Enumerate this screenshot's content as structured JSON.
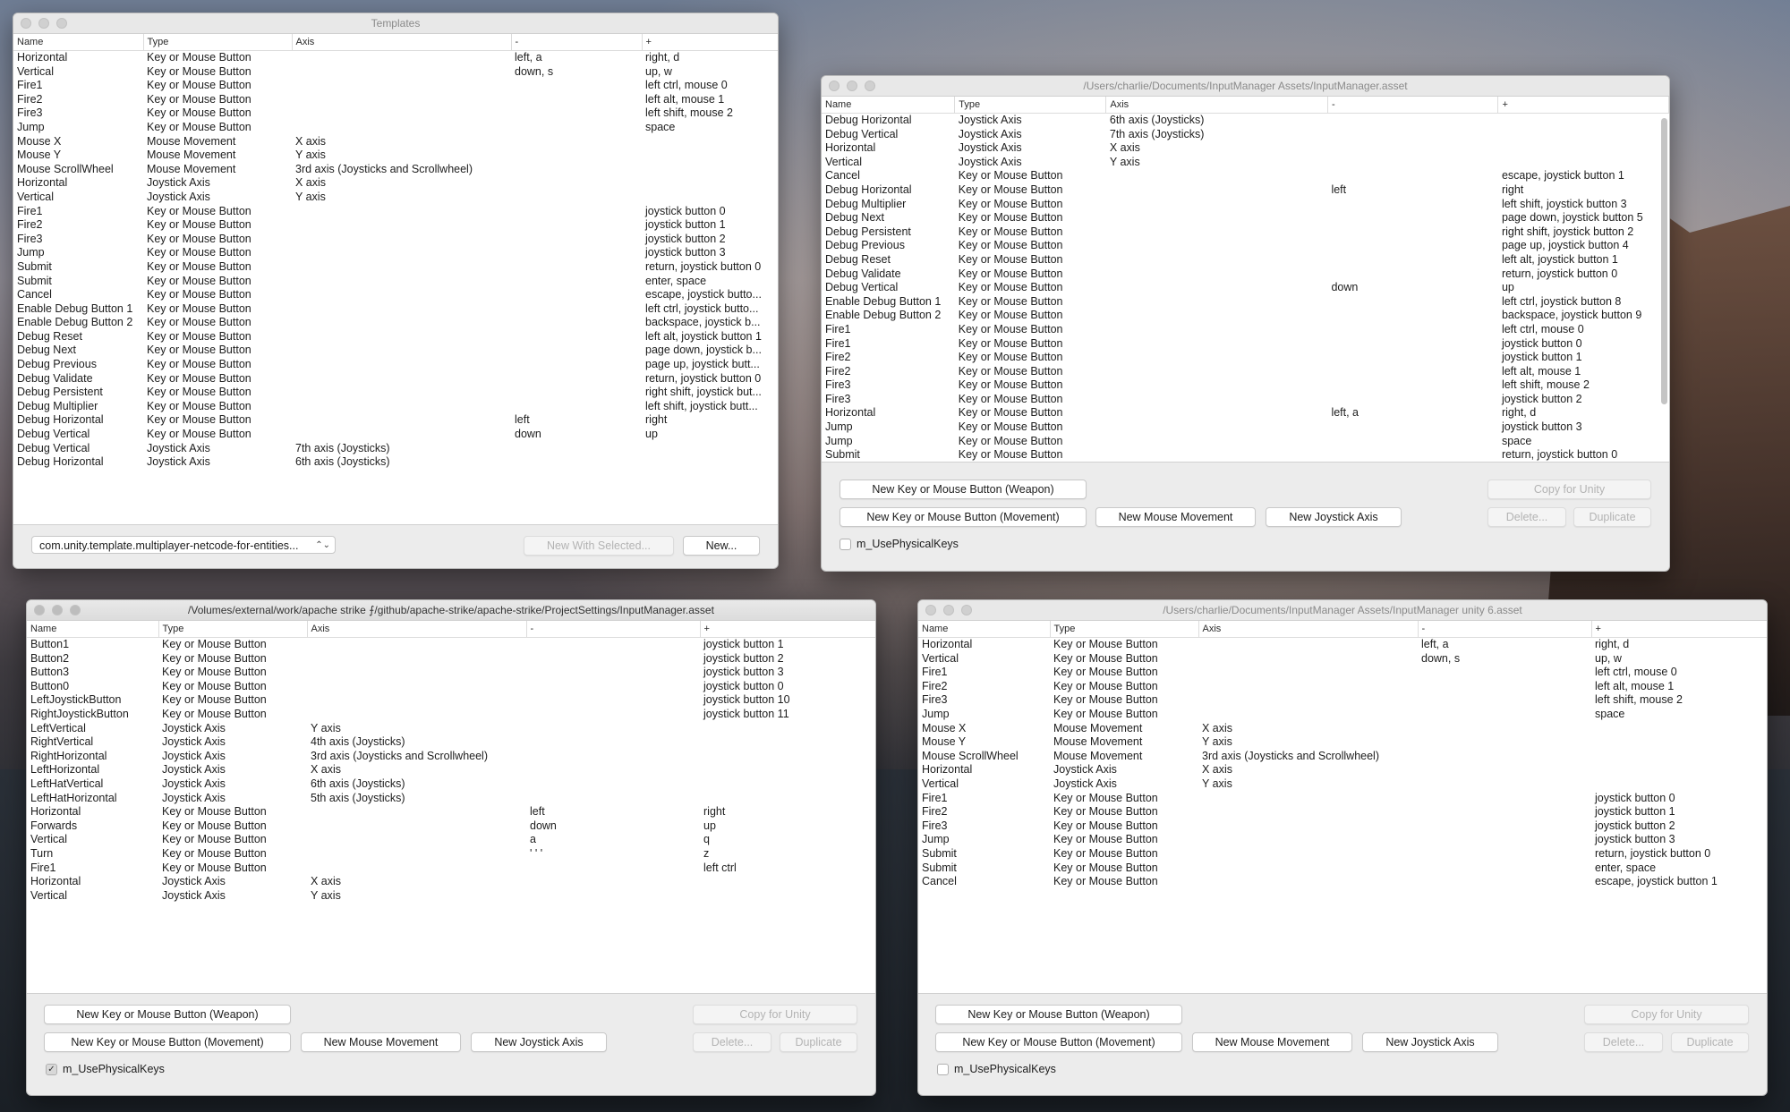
{
  "templates": {
    "title": "Templates",
    "columns": [
      "Name",
      "Type",
      "Axis",
      "-",
      "+"
    ],
    "rows": [
      [
        "Horizontal",
        "Key or Mouse Button",
        "",
        "left, a",
        "right, d"
      ],
      [
        "Vertical",
        "Key or Mouse Button",
        "",
        "down, s",
        "up, w"
      ],
      [
        "Fire1",
        "Key or Mouse Button",
        "",
        "",
        "left ctrl, mouse 0"
      ],
      [
        "Fire2",
        "Key or Mouse Button",
        "",
        "",
        "left alt, mouse 1"
      ],
      [
        "Fire3",
        "Key or Mouse Button",
        "",
        "",
        "left shift, mouse 2"
      ],
      [
        "Jump",
        "Key or Mouse Button",
        "",
        "",
        "space"
      ],
      [
        "Mouse X",
        "Mouse Movement",
        "X axis",
        "",
        ""
      ],
      [
        "Mouse Y",
        "Mouse Movement",
        "Y axis",
        "",
        ""
      ],
      [
        "Mouse ScrollWheel",
        "Mouse Movement",
        "3rd axis (Joysticks and Scrollwheel)",
        "",
        ""
      ],
      [
        "Horizontal",
        "Joystick Axis",
        "X axis",
        "",
        ""
      ],
      [
        "Vertical",
        "Joystick Axis",
        "Y axis",
        "",
        ""
      ],
      [
        "Fire1",
        "Key or Mouse Button",
        "",
        "",
        "joystick button 0"
      ],
      [
        "Fire2",
        "Key or Mouse Button",
        "",
        "",
        "joystick button 1"
      ],
      [
        "Fire3",
        "Key or Mouse Button",
        "",
        "",
        "joystick button 2"
      ],
      [
        "Jump",
        "Key or Mouse Button",
        "",
        "",
        "joystick button 3"
      ],
      [
        "Submit",
        "Key or Mouse Button",
        "",
        "",
        "return, joystick button 0"
      ],
      [
        "Submit",
        "Key or Mouse Button",
        "",
        "",
        "enter, space"
      ],
      [
        "Cancel",
        "Key or Mouse Button",
        "",
        "",
        "escape, joystick butto..."
      ],
      [
        "Enable Debug Button 1",
        "Key or Mouse Button",
        "",
        "",
        "left ctrl, joystick butto..."
      ],
      [
        "Enable Debug Button 2",
        "Key or Mouse Button",
        "",
        "",
        "backspace, joystick b..."
      ],
      [
        "Debug Reset",
        "Key or Mouse Button",
        "",
        "",
        "left alt, joystick button 1"
      ],
      [
        "Debug Next",
        "Key or Mouse Button",
        "",
        "",
        "page down, joystick b..."
      ],
      [
        "Debug Previous",
        "Key or Mouse Button",
        "",
        "",
        "page up, joystick butt..."
      ],
      [
        "Debug Validate",
        "Key or Mouse Button",
        "",
        "",
        "return, joystick button 0"
      ],
      [
        "Debug Persistent",
        "Key or Mouse Button",
        "",
        "",
        "right shift, joystick but..."
      ],
      [
        "Debug Multiplier",
        "Key or Mouse Button",
        "",
        "",
        "left shift, joystick butt..."
      ],
      [
        "Debug Horizontal",
        "Key or Mouse Button",
        "",
        "left",
        "right"
      ],
      [
        "Debug Vertical",
        "Key or Mouse Button",
        "",
        "down",
        "up"
      ],
      [
        "Debug Vertical",
        "Joystick Axis",
        "7th axis (Joysticks)",
        "",
        ""
      ],
      [
        "Debug Horizontal",
        "Joystick Axis",
        "6th axis (Joysticks)",
        "",
        ""
      ]
    ],
    "template_select": "com.unity.template.multiplayer-netcode-for-entities...",
    "select_arrows": "⌃⌄",
    "new_with_selected": "New With Selected...",
    "new": "New..."
  },
  "asset_main": {
    "title": "/Users/charlie/Documents/InputManager Assets/InputManager.asset",
    "columns": [
      "Name",
      "Type",
      "Axis",
      "-",
      "+"
    ],
    "rows": [
      [
        "Debug Horizontal",
        "Joystick Axis",
        "6th axis (Joysticks)",
        "",
        ""
      ],
      [
        "Debug Vertical",
        "Joystick Axis",
        "7th axis (Joysticks)",
        "",
        ""
      ],
      [
        "Horizontal",
        "Joystick Axis",
        "X axis",
        "",
        ""
      ],
      [
        "Vertical",
        "Joystick Axis",
        "Y axis",
        "",
        ""
      ],
      [
        "Cancel",
        "Key or Mouse Button",
        "",
        "",
        "escape, joystick button 1"
      ],
      [
        "Debug Horizontal",
        "Key or Mouse Button",
        "",
        "left",
        "right"
      ],
      [
        "Debug Multiplier",
        "Key or Mouse Button",
        "",
        "",
        "left shift, joystick button 3"
      ],
      [
        "Debug Next",
        "Key or Mouse Button",
        "",
        "",
        "page down, joystick button 5"
      ],
      [
        "Debug Persistent",
        "Key or Mouse Button",
        "",
        "",
        "right shift, joystick button 2"
      ],
      [
        "Debug Previous",
        "Key or Mouse Button",
        "",
        "",
        "page up, joystick button 4"
      ],
      [
        "Debug Reset",
        "Key or Mouse Button",
        "",
        "",
        "left alt, joystick button 1"
      ],
      [
        "Debug Validate",
        "Key or Mouse Button",
        "",
        "",
        "return, joystick button 0"
      ],
      [
        "Debug Vertical",
        "Key or Mouse Button",
        "",
        "down",
        "up"
      ],
      [
        "Enable Debug Button 1",
        "Key or Mouse Button",
        "",
        "",
        "left ctrl, joystick button 8"
      ],
      [
        "Enable Debug Button 2",
        "Key or Mouse Button",
        "",
        "",
        "backspace, joystick button 9"
      ],
      [
        "Fire1",
        "Key or Mouse Button",
        "",
        "",
        "left ctrl, mouse 0"
      ],
      [
        "Fire1",
        "Key or Mouse Button",
        "",
        "",
        "joystick button 0"
      ],
      [
        "Fire2",
        "Key or Mouse Button",
        "",
        "",
        "joystick button 1"
      ],
      [
        "Fire2",
        "Key or Mouse Button",
        "",
        "",
        "left alt, mouse 1"
      ],
      [
        "Fire3",
        "Key or Mouse Button",
        "",
        "",
        "left shift, mouse 2"
      ],
      [
        "Fire3",
        "Key or Mouse Button",
        "",
        "",
        "joystick button 2"
      ],
      [
        "Horizontal",
        "Key or Mouse Button",
        "",
        "left, a",
        "right, d"
      ],
      [
        "Jump",
        "Key or Mouse Button",
        "",
        "",
        "joystick button 3"
      ],
      [
        "Jump",
        "Key or Mouse Button",
        "",
        "",
        "space"
      ],
      [
        "Submit",
        "Key or Mouse Button",
        "",
        "",
        "return, joystick button 0"
      ]
    ],
    "buttons": {
      "new_weapon": "New Key or Mouse Button (Weapon)",
      "new_movement": "New Key or Mouse Button (Movement)",
      "new_mouse": "New Mouse Movement",
      "new_joystick": "New Joystick Axis",
      "copy_unity": "Copy for Unity",
      "delete": "Delete...",
      "duplicate": "Duplicate"
    },
    "physical_keys_label": "m_UsePhysicalKeys",
    "physical_keys_checked": false
  },
  "asset_apache": {
    "title": "/Volumes/external/work/apache strike ⨍/github/apache-strike/apache-strike/ProjectSettings/InputManager.asset",
    "columns": [
      "Name",
      "Type",
      "Axis",
      "-",
      "+"
    ],
    "rows": [
      [
        "Button1",
        "Key or Mouse Button",
        "",
        "",
        "joystick button 1"
      ],
      [
        "Button2",
        "Key or Mouse Button",
        "",
        "",
        "joystick button 2"
      ],
      [
        "Button3",
        "Key or Mouse Button",
        "",
        "",
        "joystick button 3"
      ],
      [
        "Button0",
        "Key or Mouse Button",
        "",
        "",
        "joystick button 0"
      ],
      [
        "LeftJoystickButton",
        "Key or Mouse Button",
        "",
        "",
        "joystick button 10"
      ],
      [
        "RightJoystickButton",
        "Key or Mouse Button",
        "",
        "",
        "joystick button 11"
      ],
      [
        "LeftVertical",
        "Joystick Axis",
        "Y axis",
        "",
        ""
      ],
      [
        "RightVertical",
        "Joystick Axis",
        "4th axis (Joysticks)",
        "",
        ""
      ],
      [
        "RightHorizontal",
        "Joystick Axis",
        "3rd axis (Joysticks and Scrollwheel)",
        "",
        ""
      ],
      [
        "LeftHorizontal",
        "Joystick Axis",
        "X axis",
        "",
        ""
      ],
      [
        "LeftHatVertical",
        "Joystick Axis",
        "6th axis (Joysticks)",
        "",
        ""
      ],
      [
        "LeftHatHorizontal",
        "Joystick Axis",
        "5th axis (Joysticks)",
        "",
        ""
      ],
      [
        "Horizontal",
        "Key or Mouse Button",
        "",
        "left",
        "right"
      ],
      [
        "Forwards",
        "Key or Mouse Button",
        "",
        "down",
        "up"
      ],
      [
        "Vertical",
        "Key or Mouse Button",
        "",
        "a",
        "q"
      ],
      [
        "Turn",
        "Key or Mouse Button",
        "",
        "' ' '",
        "z"
      ],
      [
        "Fire1",
        "Key or Mouse Button",
        "",
        "",
        "left ctrl"
      ],
      [
        "Horizontal",
        "Joystick Axis",
        "X axis",
        "",
        ""
      ],
      [
        "Vertical",
        "Joystick Axis",
        "Y axis",
        "",
        ""
      ]
    ],
    "buttons": {
      "new_weapon": "New Key or Mouse Button (Weapon)",
      "new_movement": "New Key or Mouse Button (Movement)",
      "new_mouse": "New Mouse Movement",
      "new_joystick": "New Joystick Axis",
      "copy_unity": "Copy for Unity",
      "delete": "Delete...",
      "duplicate": "Duplicate"
    },
    "physical_keys_label": "m_UsePhysicalKeys",
    "physical_keys_checked": true,
    "check_mark": "✓"
  },
  "asset_unity6": {
    "title": "/Users/charlie/Documents/InputManager Assets/InputManager unity 6.asset",
    "columns": [
      "Name",
      "Type",
      "Axis",
      "-",
      "+"
    ],
    "rows": [
      [
        "Horizontal",
        "Key or Mouse Button",
        "",
        "left, a",
        "right, d"
      ],
      [
        "Vertical",
        "Key or Mouse Button",
        "",
        "down, s",
        "up, w"
      ],
      [
        "Fire1",
        "Key or Mouse Button",
        "",
        "",
        "left ctrl, mouse 0"
      ],
      [
        "Fire2",
        "Key or Mouse Button",
        "",
        "",
        "left alt, mouse 1"
      ],
      [
        "Fire3",
        "Key or Mouse Button",
        "",
        "",
        "left shift, mouse 2"
      ],
      [
        "Jump",
        "Key or Mouse Button",
        "",
        "",
        "space"
      ],
      [
        "Mouse X",
        "Mouse Movement",
        "X axis",
        "",
        ""
      ],
      [
        "Mouse Y",
        "Mouse Movement",
        "Y axis",
        "",
        ""
      ],
      [
        "Mouse ScrollWheel",
        "Mouse Movement",
        "3rd axis (Joysticks and Scrollwheel)",
        "",
        ""
      ],
      [
        "Horizontal",
        "Joystick Axis",
        "X axis",
        "",
        ""
      ],
      [
        "Vertical",
        "Joystick Axis",
        "Y axis",
        "",
        ""
      ],
      [
        "Fire1",
        "Key or Mouse Button",
        "",
        "",
        "joystick button 0"
      ],
      [
        "Fire2",
        "Key or Mouse Button",
        "",
        "",
        "joystick button 1"
      ],
      [
        "Fire3",
        "Key or Mouse Button",
        "",
        "",
        "joystick button 2"
      ],
      [
        "Jump",
        "Key or Mouse Button",
        "",
        "",
        "joystick button 3"
      ],
      [
        "Submit",
        "Key or Mouse Button",
        "",
        "",
        "return, joystick button 0"
      ],
      [
        "Submit",
        "Key or Mouse Button",
        "",
        "",
        "enter, space"
      ],
      [
        "Cancel",
        "Key or Mouse Button",
        "",
        "",
        "escape, joystick button 1"
      ]
    ],
    "buttons": {
      "new_weapon": "New Key or Mouse Button (Weapon)",
      "new_movement": "New Key or Mouse Button (Movement)",
      "new_mouse": "New Mouse Movement",
      "new_joystick": "New Joystick Axis",
      "copy_unity": "Copy for Unity",
      "delete": "Delete...",
      "duplicate": "Duplicate"
    },
    "physical_keys_label": "m_UsePhysicalKeys",
    "physical_keys_checked": false
  }
}
